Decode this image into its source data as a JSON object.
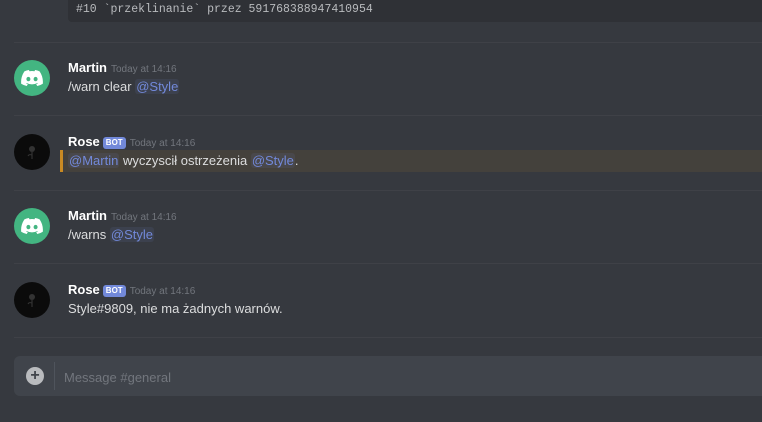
{
  "code_block": {
    "text": "#10  `przeklinanie` przez 591768388947410954"
  },
  "messages": [
    {
      "author": "Martin",
      "timestamp": "Today at 14:16",
      "text": "/warn clear ",
      "mention": "@Style"
    },
    {
      "author": "Rose",
      "bot_tag": "BOT",
      "timestamp": "Today at 14:16",
      "mention1": "@Martin",
      "text": " wyczyscił ostrzeżenia ",
      "mention2": "@Style",
      "text_end": "."
    },
    {
      "author": "Martin",
      "timestamp": "Today at 14:16",
      "text": "/warns ",
      "mention": "@Style"
    },
    {
      "author": "Rose",
      "bot_tag": "BOT",
      "timestamp": "Today at 14:16",
      "text": "Style#9809, nie ma żadnych warnów."
    }
  ],
  "composer": {
    "placeholder": "Message #general",
    "add_icon": "+"
  },
  "colors": {
    "background": "#36393f",
    "mention": "#7289da",
    "highlight_border": "#faa61a",
    "bot_tag": "#7289da",
    "avatar_discord": "#43b581"
  }
}
